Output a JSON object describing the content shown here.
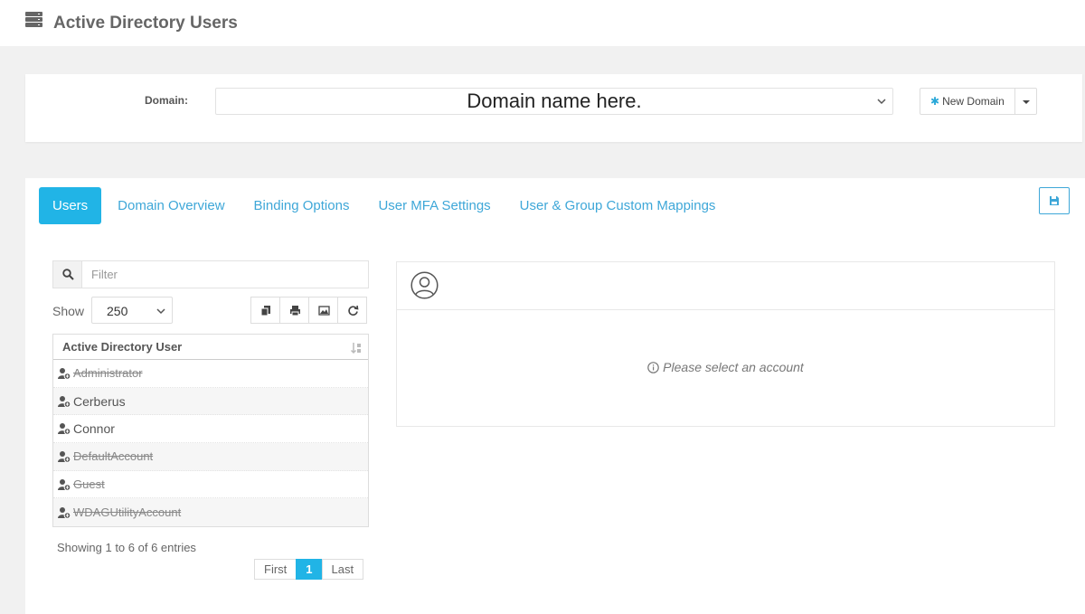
{
  "header": {
    "title": "Active Directory Users",
    "icon": "server-icon"
  },
  "domain": {
    "label": "Domain:",
    "value": "Domain name here.",
    "new_button": "New Domain"
  },
  "tabs": [
    {
      "label": "Users",
      "active": true
    },
    {
      "label": "Domain Overview",
      "active": false
    },
    {
      "label": "Binding Options",
      "active": false
    },
    {
      "label": "User MFA Settings",
      "active": false
    },
    {
      "label": "User & Group Custom Mappings",
      "active": false
    }
  ],
  "filter": {
    "placeholder": "Filter"
  },
  "show": {
    "label": "Show",
    "value": "250"
  },
  "table": {
    "header": "Active Directory User",
    "rows": [
      {
        "name": "Administrator",
        "disabled": true
      },
      {
        "name": "Cerberus",
        "disabled": false
      },
      {
        "name": "Connor",
        "disabled": false
      },
      {
        "name": "DefaultAccount",
        "disabled": true
      },
      {
        "name": "Guest",
        "disabled": true
      },
      {
        "name": "WDAGUtilityAccount",
        "disabled": true
      }
    ]
  },
  "info": {
    "showing": "Showing 1 to 6 of 6 entries"
  },
  "pagination": {
    "first": "First",
    "current": "1",
    "last": "Last"
  },
  "detail": {
    "message": "Please select an account"
  },
  "colors": {
    "accent": "#21b4e6",
    "link": "#3ea7d8"
  }
}
